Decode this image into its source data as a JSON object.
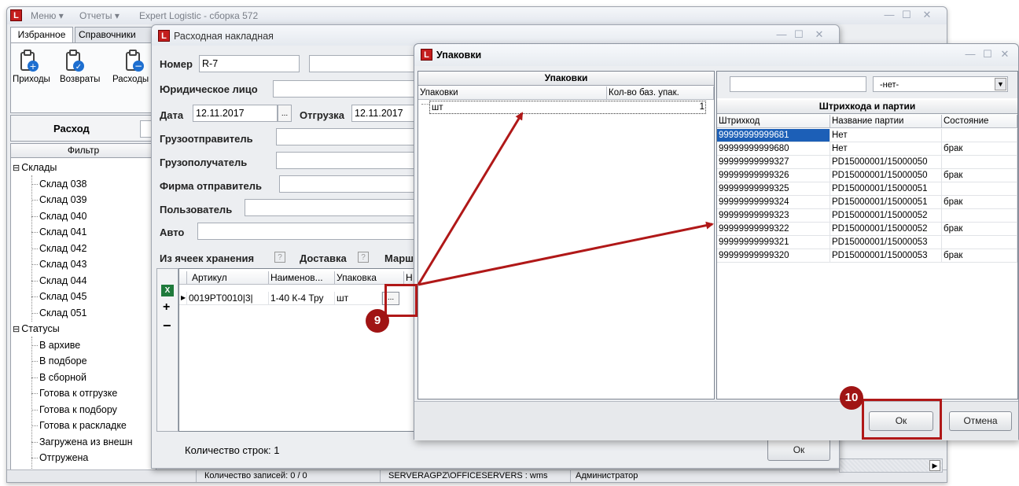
{
  "main_window": {
    "menu": [
      "Меню ▾",
      "Отчеты ▾"
    ],
    "title": "Expert Logistic - сборка 572",
    "tabs": [
      "Избранное",
      "Справочники"
    ],
    "toolbar": [
      "Приходы",
      "Возвраты",
      "Расходы"
    ],
    "section_title": "Расход",
    "filter_header": "Фильтр",
    "tree": {
      "warehouses_label": "Склады",
      "warehouses": [
        "Склад 038",
        "Склад 039",
        "Склад 040",
        "Склад 041",
        "Склад 042",
        "Склад 043",
        "Склад 044",
        "Склад 045",
        "Склад 051"
      ],
      "statuses_label": "Статусы",
      "statuses": [
        "В архиве",
        "В подборе",
        "В сборной",
        "Готова к отгрузке",
        "Готова к подбору",
        "Готова к раскладке",
        "Загружена из внешн",
        "Отгружена"
      ]
    },
    "status_bar": {
      "records": "Количество записей: 0 / 0",
      "server": "SERVERAGPZ\\OFFICESERVERS : wms",
      "user": "Администратор"
    }
  },
  "invoice": {
    "title": "Расходная накладная",
    "labels": {
      "number": "Номер",
      "legal_entity": "Юридическое лицо",
      "date": "Дата",
      "shipment": "Отгрузка",
      "consignor": "Грузоотправитель",
      "consignee": "Грузополучатель",
      "sender_firm": "Фирма отправитель",
      "user": "Пользователь",
      "auto": "Авто",
      "from_cells": "Из ячеек хранения",
      "delivery": "Доставка",
      "route": "Марш"
    },
    "values": {
      "number": "R-7",
      "date": "12.11.2017",
      "shipment": "12.11.2017"
    },
    "table": {
      "columns": [
        "Артикул",
        "Наименов...",
        "Упаковка",
        "Н"
      ],
      "row": [
        "0019PT0010|3|",
        "1-40 К-4 Тру",
        "шт"
      ]
    },
    "row_count": "Количество строк: 1",
    "ok": "Ок"
  },
  "packages_dialog": {
    "title": "Упаковки",
    "left_grid": {
      "header": "Упаковки",
      "columns": [
        "Упаковки",
        "Кол-во баз. упак."
      ],
      "rows": [
        [
          "шт",
          "1"
        ]
      ]
    },
    "filter_select": "-нет-",
    "right_grid": {
      "header": "Штрихкода и партии",
      "columns": [
        "Штрихкод",
        "Название партии",
        "Состояние"
      ],
      "rows": [
        [
          "99999999999681",
          "Нет",
          ""
        ],
        [
          "99999999999680",
          "Нет",
          "брак"
        ],
        [
          "99999999999327",
          "PD15000001/15000050",
          ""
        ],
        [
          "99999999999326",
          "PD15000001/15000050",
          "брак"
        ],
        [
          "99999999999325",
          "PD15000001/15000051",
          ""
        ],
        [
          "99999999999324",
          "PD15000001/15000051",
          "брак"
        ],
        [
          "99999999999323",
          "PD15000001/15000052",
          ""
        ],
        [
          "99999999999322",
          "PD15000001/15000052",
          "брак"
        ],
        [
          "99999999999321",
          "PD15000001/15000053",
          ""
        ],
        [
          "99999999999320",
          "PD15000001/15000053",
          "брак"
        ]
      ]
    },
    "ok": "Ок",
    "cancel": "Отмена"
  },
  "annotations": {
    "step9": "9",
    "step10": "10"
  },
  "colors": {
    "selection": "#1c5fb7",
    "annotation_red": "#b01818"
  }
}
